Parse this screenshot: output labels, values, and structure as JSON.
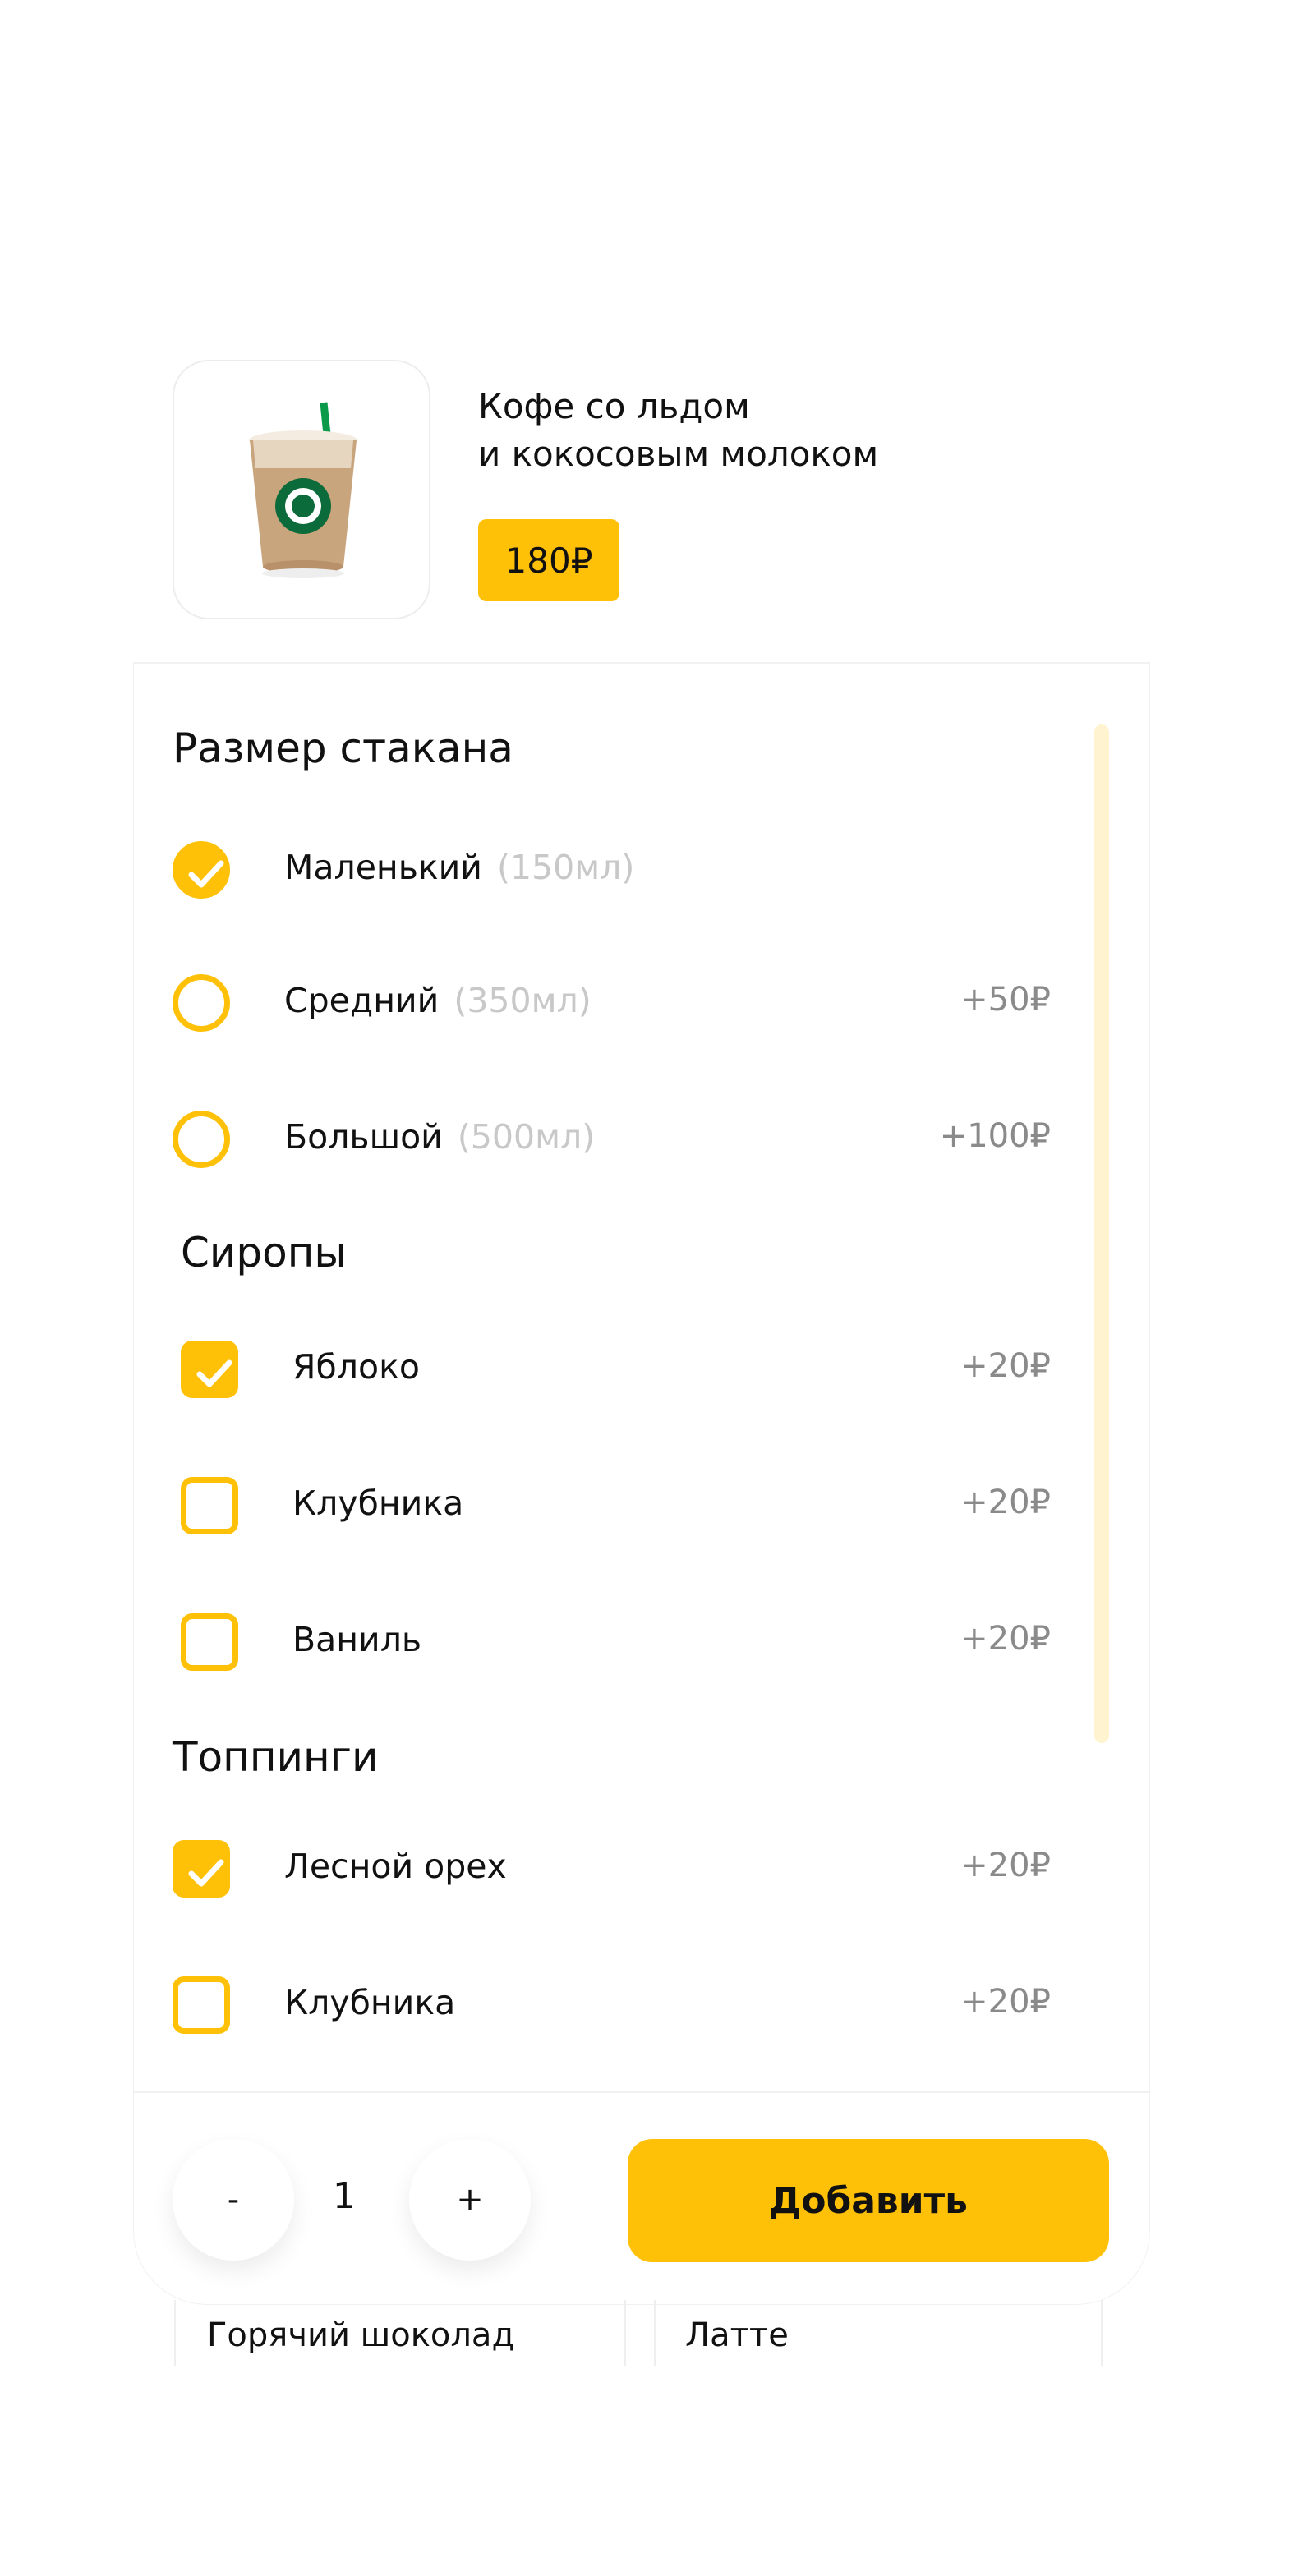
{
  "product": {
    "title_line1": "Кофе со льдом",
    "title_line2": "и кокосовым молоком",
    "price": "180₽",
    "image_icon": "iced-coffee-cup"
  },
  "sections": {
    "size": {
      "title": "Размер стакана",
      "options": [
        {
          "label": "Маленький",
          "volume": "(150мл)",
          "price": "",
          "checked": true
        },
        {
          "label": "Средний",
          "volume": "(350мл)",
          "price": "+50₽",
          "checked": false
        },
        {
          "label": "Большой",
          "volume": "(500мл)",
          "price": "+100₽",
          "checked": false
        }
      ]
    },
    "syrups": {
      "title": "Сиропы",
      "options": [
        {
          "label": "Яблоко",
          "price": "+20₽",
          "checked": true
        },
        {
          "label": "Клубника",
          "price": "+20₽",
          "checked": false
        },
        {
          "label": "Ваниль",
          "price": "+20₽",
          "checked": false
        }
      ]
    },
    "toppings": {
      "title": "Топпинги",
      "options": [
        {
          "label": "Лесной орех",
          "price": "+20₽",
          "checked": true
        },
        {
          "label": "Клубника",
          "price": "+20₽",
          "checked": false
        }
      ]
    }
  },
  "footer": {
    "minus": "-",
    "quantity": "1",
    "plus": "+",
    "add_label": "Добавить"
  },
  "next_cards": [
    "Горячий шоколад",
    "Латте"
  ],
  "colors": {
    "accent": "#FFC107",
    "scrollbar": "#FFF4CF"
  }
}
